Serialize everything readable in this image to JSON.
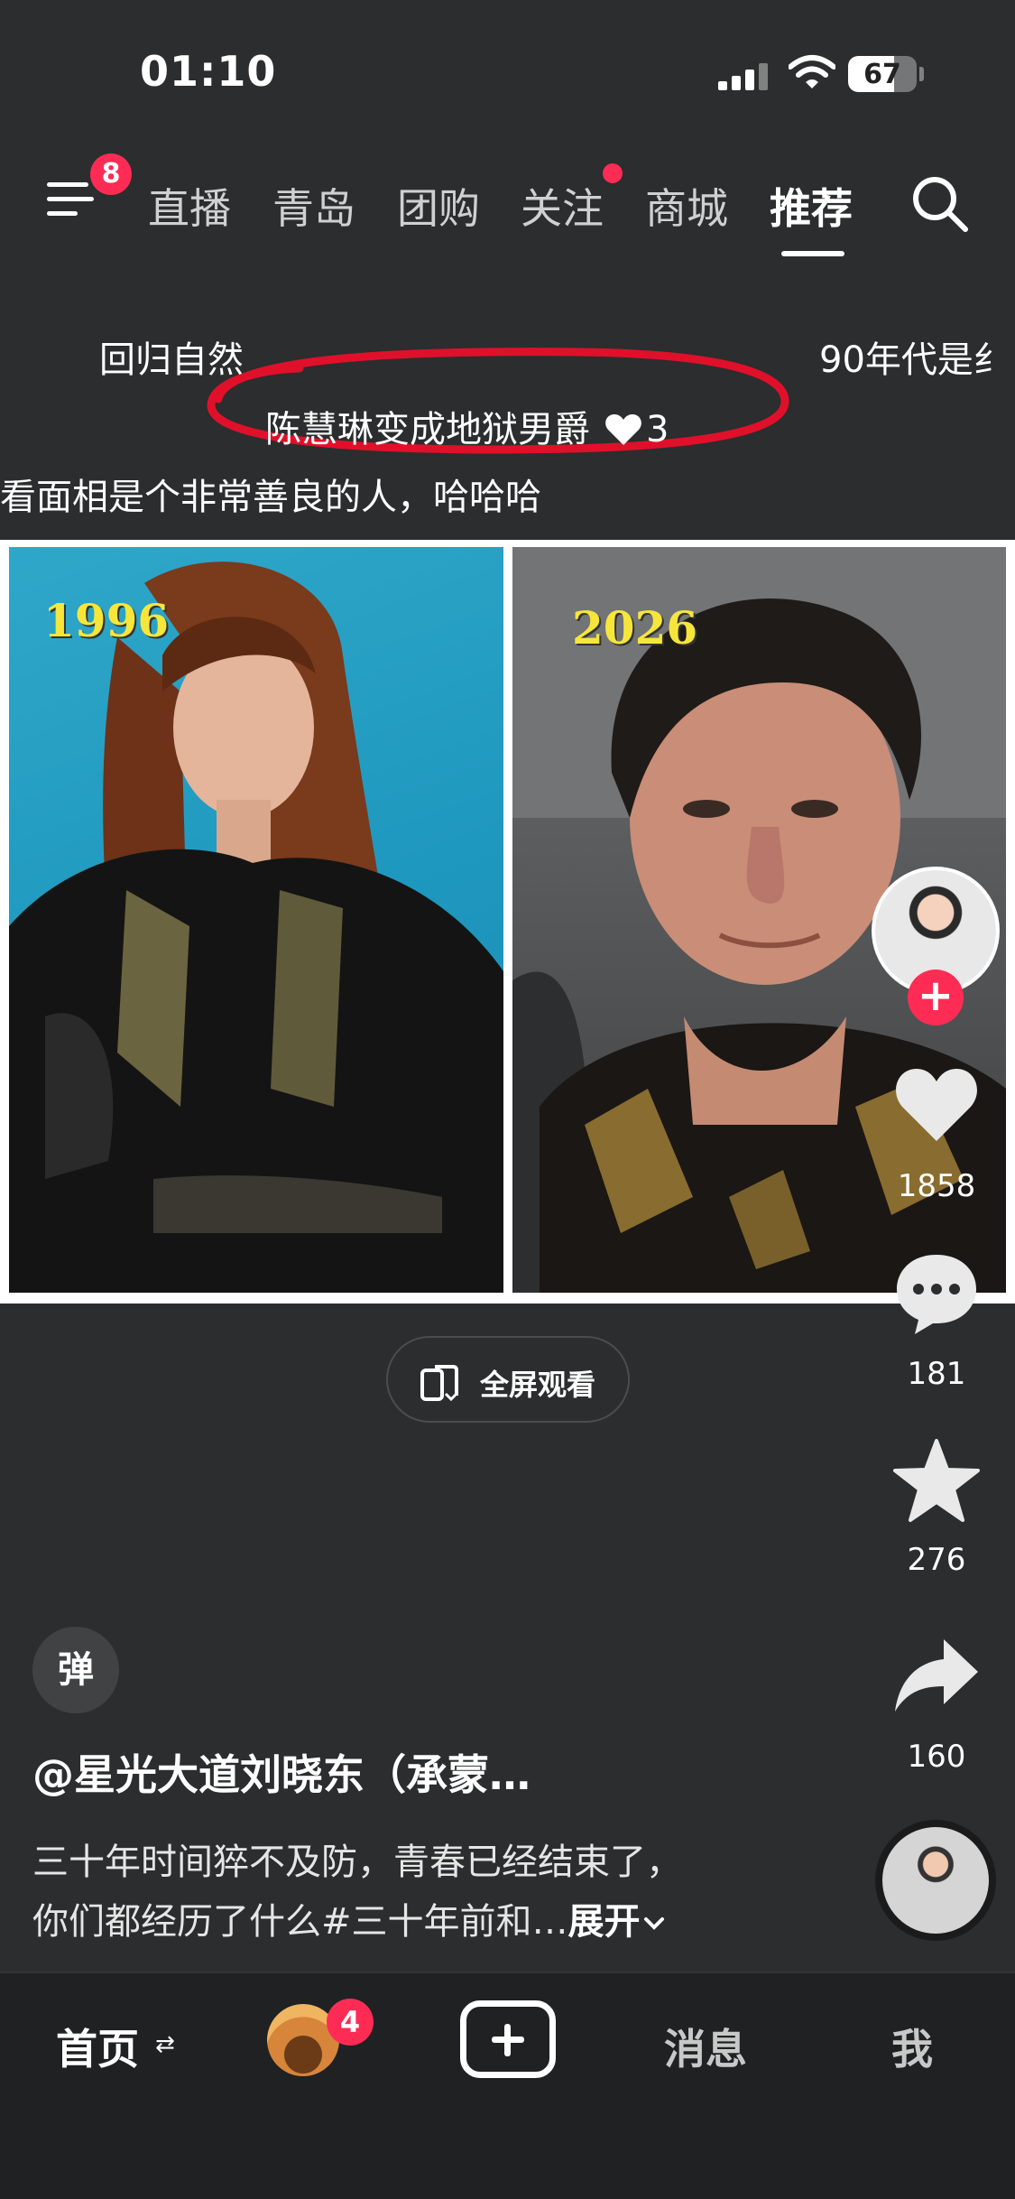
{
  "status_bar": {
    "time": "01:10",
    "battery_percent": "67",
    "battery_level": 0.67
  },
  "top_nav": {
    "menu_badge": "8",
    "tabs": [
      {
        "label": "直播"
      },
      {
        "label": "青岛"
      },
      {
        "label": "团购"
      },
      {
        "label": "关注"
      },
      {
        "label": "商城"
      },
      {
        "label": "推荐"
      }
    ],
    "active_tab": "推荐"
  },
  "danmaku": {
    "line1_left": "回归自然",
    "line1_right": "90年代是纟",
    "highlighted": "陈慧琳变成地狱男爵",
    "highlighted_likes": "3",
    "line3": "看面相是个非常善良的人，哈哈哈"
  },
  "media": {
    "left_year": "1996",
    "right_year": "2026",
    "fullscreen_label": "全屏观看"
  },
  "right_rail": {
    "likes": "1858",
    "comments": "181",
    "favorites": "276",
    "shares": "160"
  },
  "post": {
    "danmu_toggle": "弹",
    "author": "@星光大道刘晓东（承蒙…",
    "caption_line1": "三十年时间猝不及防，青春已经结束了，",
    "caption_line2": "你们都经历了什么#三十年前和…",
    "expand_label": "展开"
  },
  "bottom_bar": {
    "home": "首页",
    "friends_badge": "4",
    "messages": "消息",
    "me": "我"
  },
  "colors": {
    "background": "#2b2d2e",
    "accent": "#fe2c55",
    "year_label": "#f6e63b",
    "highlight_circle": "#e0102a"
  },
  "icons": [
    "menu-icon",
    "search-icon",
    "heart-icon",
    "comment-icon",
    "star-icon",
    "share-icon",
    "fullscreen-icon",
    "create-plus-icon"
  ]
}
